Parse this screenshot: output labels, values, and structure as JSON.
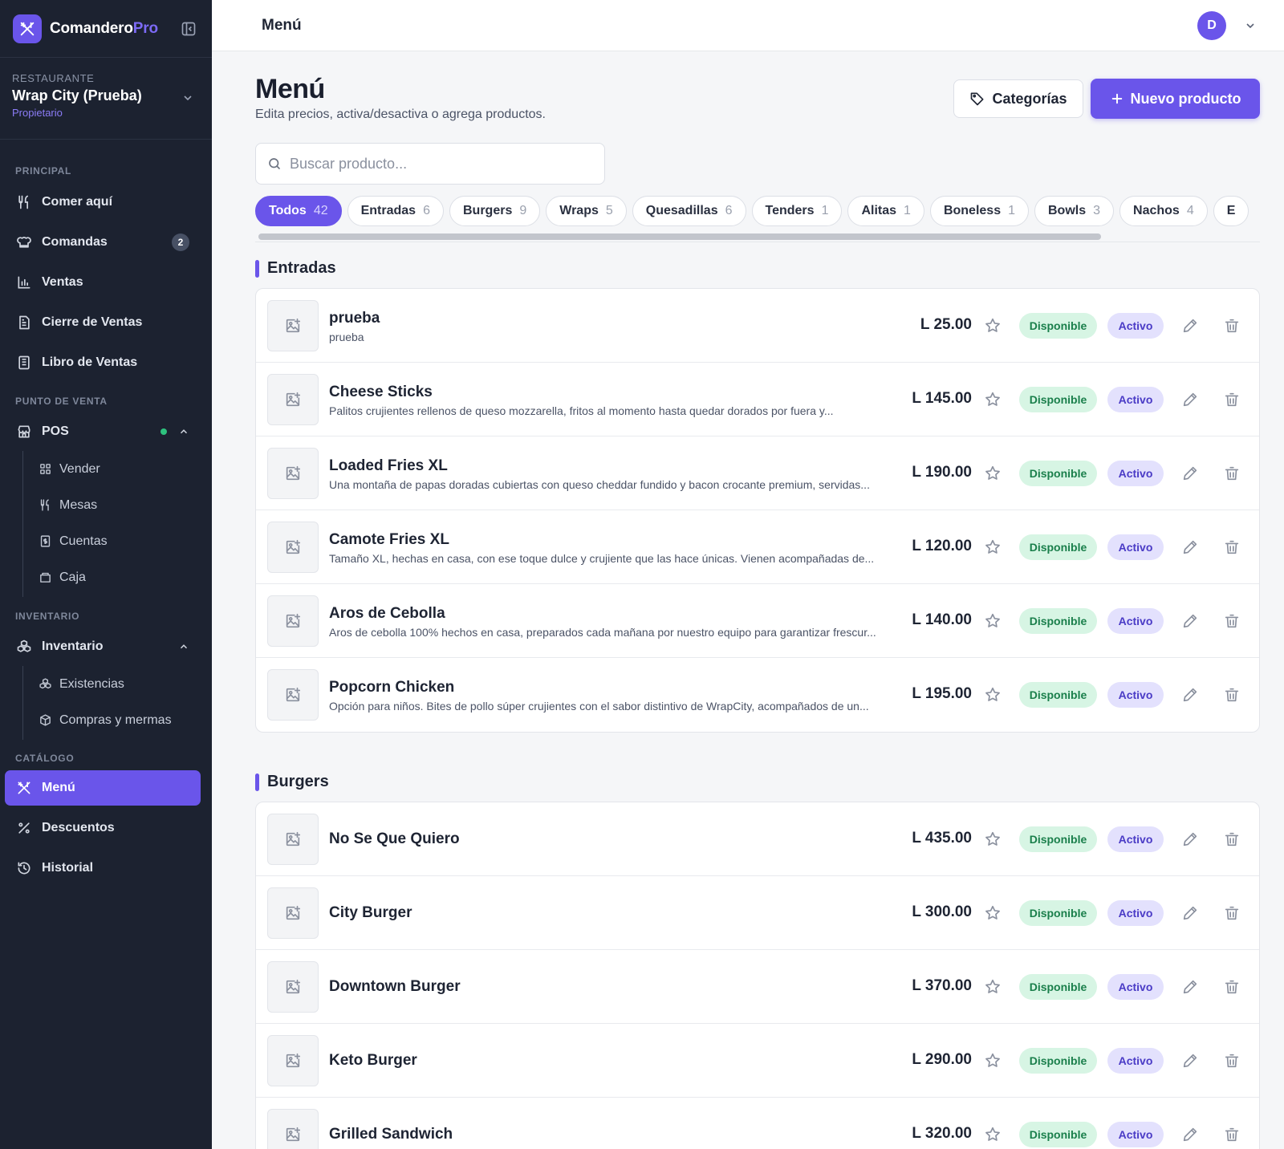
{
  "brand": {
    "name": "Comandero",
    "suffix": "Pro"
  },
  "restaurant": {
    "label": "RESTAURANTE",
    "name": "Wrap City (Prueba)",
    "role": "Propietario"
  },
  "sidebar": {
    "sections": {
      "principal": "PRINCIPAL",
      "punto_venta": "PUNTO DE VENTA",
      "inventario": "INVENTARIO",
      "catalogo": "CATÁLOGO"
    },
    "items": {
      "comer_aqui": "Comer aquí",
      "comandas": "Comandas",
      "comandas_badge": "2",
      "ventas": "Ventas",
      "cierre": "Cierre de Ventas",
      "libro": "Libro de Ventas",
      "pos": "POS",
      "vender": "Vender",
      "mesas": "Mesas",
      "cuentas": "Cuentas",
      "caja": "Caja",
      "inventario": "Inventario",
      "existencias": "Existencias",
      "compras": "Compras y mermas",
      "menu": "Menú",
      "descuentos": "Descuentos",
      "historial": "Historial"
    }
  },
  "topbar": {
    "title": "Menú",
    "avatar_initial": "D"
  },
  "page": {
    "title": "Menú",
    "subtitle": "Edita precios, activa/desactiva o agrega productos.",
    "categories_button": "Categorías",
    "new_product_button": "Nuevo producto",
    "search_placeholder": "Buscar producto..."
  },
  "chips": [
    {
      "label": "Todos",
      "count": "42",
      "active": true
    },
    {
      "label": "Entradas",
      "count": "6"
    },
    {
      "label": "Burgers",
      "count": "9"
    },
    {
      "label": "Wraps",
      "count": "5"
    },
    {
      "label": "Quesadillas",
      "count": "6"
    },
    {
      "label": "Tenders",
      "count": "1"
    },
    {
      "label": "Alitas",
      "count": "1"
    },
    {
      "label": "Boneless",
      "count": "1"
    },
    {
      "label": "Bowls",
      "count": "3"
    },
    {
      "label": "Nachos",
      "count": "4"
    },
    {
      "label": "E",
      "count": ""
    }
  ],
  "labels": {
    "available": "Disponible",
    "active": "Activo"
  },
  "categories": [
    {
      "name": "Entradas",
      "products": [
        {
          "name": "prueba",
          "desc": "prueba",
          "price": "L 25.00"
        },
        {
          "name": "Cheese Sticks",
          "desc": "Palitos crujientes rellenos de queso mozzarella, fritos al momento hasta quedar dorados por fuera y...",
          "price": "L 145.00"
        },
        {
          "name": "Loaded Fries XL",
          "desc": "Una montaña de papas doradas cubiertas con queso cheddar fundido y bacon crocante premium, servidas...",
          "price": "L 190.00"
        },
        {
          "name": "Camote Fries XL",
          "desc": "Tamaño XL, hechas en casa, con ese toque dulce y crujiente que las hace únicas. Vienen acompañadas de...",
          "price": "L 120.00"
        },
        {
          "name": "Aros de Cebolla",
          "desc": "Aros de cebolla 100% hechos en casa, preparados cada mañana por nuestro equipo para garantizar frescur...",
          "price": "L 140.00"
        },
        {
          "name": "Popcorn Chicken",
          "desc": "Opción para niños. Bites de pollo súper crujientes con el sabor distintivo de WrapCity, acompañados de un...",
          "price": "L 195.00"
        }
      ]
    },
    {
      "name": "Burgers",
      "products": [
        {
          "name": "No Se Que Quiero",
          "desc": "",
          "price": "L 435.00"
        },
        {
          "name": "City Burger",
          "desc": "",
          "price": "L 300.00"
        },
        {
          "name": "Downtown Burger",
          "desc": "",
          "price": "L 370.00"
        },
        {
          "name": "Keto Burger",
          "desc": "",
          "price": "L 290.00"
        },
        {
          "name": "Grilled Sandwich",
          "desc": "",
          "price": "L 320.00"
        }
      ]
    }
  ]
}
